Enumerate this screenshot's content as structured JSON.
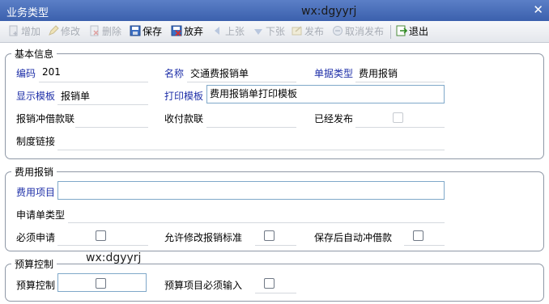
{
  "window": {
    "title": "业务类型",
    "close_glyph": "✕"
  },
  "watermark": "wx:dgyyrj",
  "toolbar": {
    "add": "增加",
    "edit": "修改",
    "delete": "删除",
    "save": "保存",
    "discard": "放弃",
    "prev": "上张",
    "next": "下张",
    "publish": "发布",
    "unpublish": "取消发布",
    "exit": "退出"
  },
  "basic": {
    "legend": "基本信息",
    "code_label": "编码",
    "code_value": "201",
    "name_label": "名称",
    "name_value": "交通费报销单",
    "doc_type_label": "单据类型",
    "doc_type_value": "费用报销",
    "display_tpl_label": "显示模板",
    "display_tpl_value": "报销单",
    "print_tpl_label": "打印模板",
    "print_tpl_value": "费用报销单打印模板",
    "offset_label": "报销冲借款联",
    "offset_value": "",
    "payment_label": "收付款联",
    "payment_value": "",
    "published_label": "已经发布",
    "policy_link_label": "制度链接",
    "policy_link_value": ""
  },
  "expense": {
    "legend": "费用报销",
    "item_label": "费用项目",
    "item_value": "",
    "request_type_label": "申请单类型",
    "request_type_value": "",
    "must_apply_label": "必须申请",
    "allow_modify_label": "允许修改报销标准",
    "auto_offset_label": "保存后自动冲借款"
  },
  "budget": {
    "legend": "预算控制",
    "control_label": "预算控制",
    "item_required_label": "预算项目必须输入"
  }
}
